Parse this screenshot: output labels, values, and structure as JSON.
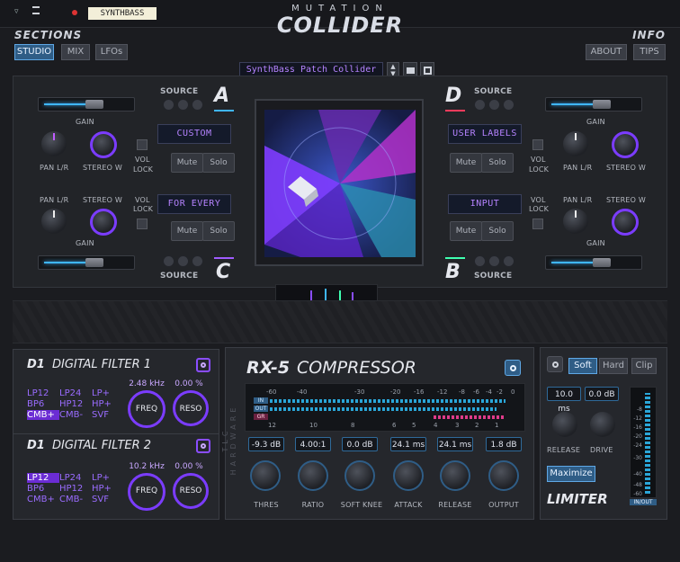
{
  "topbar": {
    "preset_badge": "SYNTHBASS",
    "title_top": "MUTATION",
    "title_main": "COLLIDER"
  },
  "sections": {
    "label": "SECTIONS",
    "tabs": [
      "STUDIO",
      "MIX",
      "LFOs"
    ]
  },
  "info": {
    "label": "INFO",
    "buttons": [
      "ABOUT",
      "TIPS"
    ]
  },
  "preset": {
    "name": "SynthBass Patch Collider"
  },
  "source_label": "SOURCE",
  "common": {
    "gain": "GAIN",
    "pan": "PAN L/R",
    "stereo": "STEREO W",
    "vol": "VOL",
    "lock": "LOCK",
    "mute": "Mute",
    "solo": "Solo"
  },
  "sources": {
    "A": {
      "letter": "A",
      "display": "CUSTOM",
      "accent": "#3fb6ff"
    },
    "C": {
      "letter": "C",
      "display": "FOR EVERY",
      "accent": "#a05cff"
    },
    "D": {
      "letter": "D",
      "display": "USER LABELS",
      "accent": "#ff3b5c"
    },
    "B": {
      "letter": "B",
      "display": "INPUT",
      "accent": "#3fffb0"
    }
  },
  "filter1": {
    "title_a": "D1",
    "title_b": "DIGITAL FILTER 1",
    "types": [
      "LP12",
      "LP24",
      "LP+",
      "BP6",
      "HP12",
      "HP+",
      "CMB+",
      "CMB-",
      "SVF"
    ],
    "selected": "CMB+",
    "freq_value": "2.48 kHz",
    "reso_value": "0.00 %",
    "freq_label": "FREQ",
    "reso_label": "RESO"
  },
  "filter2": {
    "title_a": "D1",
    "title_b": "DIGITAL FILTER 2",
    "types": [
      "LP12",
      "LP24",
      "LP+",
      "BP6",
      "HP12",
      "HP+",
      "CMB+",
      "CMB-",
      "SVF"
    ],
    "selected": "LP12",
    "freq_value": "10.2 kHz",
    "reso_value": "0.00 %",
    "freq_label": "FREQ",
    "reso_label": "RESO"
  },
  "compressor": {
    "title_a": "RX-5",
    "title_b": "COMPRESSOR",
    "side_text": "TLC HARDWARE",
    "top_scale": [
      "-60",
      "-40",
      "-30",
      "-20",
      "-16",
      "-12",
      "-8",
      "-6",
      "-4",
      "-2",
      "0"
    ],
    "bottom_scale": [
      "12",
      "10",
      "8",
      "6",
      "5",
      "4",
      "3",
      "2",
      "1"
    ],
    "meter_labels": [
      "IN",
      "OUT",
      "GR"
    ],
    "readouts": [
      "-9.3 dB",
      "4.00:1",
      "0.0 dB",
      "24.1 ms",
      "24.1 ms",
      "1.8 dB"
    ],
    "knob_labels": [
      "THRES",
      "RATIO",
      "SOFT KNEE",
      "ATTACK",
      "RELEASE",
      "OUTPUT"
    ]
  },
  "limiter": {
    "modes": [
      "Soft",
      "Hard",
      "Clip"
    ],
    "selected_mode": "Soft",
    "release_value": "10.0 ms",
    "drive_value": "0.0 dB",
    "release_label": "RELEASE",
    "drive_label": "DRIVE",
    "maximize": "Maximize",
    "title": "LIMITER",
    "scale": [
      "-8",
      "-12",
      "-16",
      "-20",
      "-24",
      "-30",
      "-40",
      "-48",
      "-60"
    ],
    "inout": "IN/OUT"
  }
}
